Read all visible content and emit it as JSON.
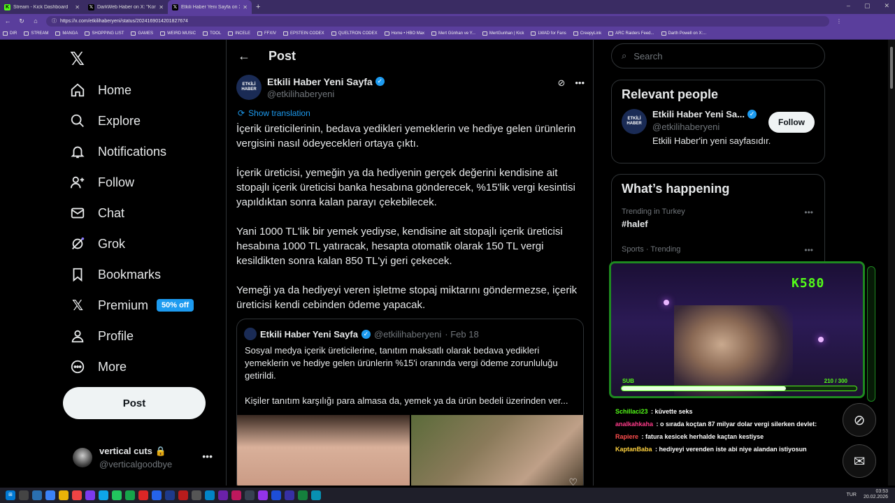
{
  "browser": {
    "tabs": [
      {
        "title": "Stream - Kick Dashboard",
        "icon": "kick"
      },
      {
        "title": "DarkWeb Haber on X: \"Konya Böy...",
        "icon": "x"
      },
      {
        "title": "Etkili Haber Yeni Sayfa on X: \"İçeri...",
        "icon": "x"
      }
    ],
    "url": "https://x.com/etkilihaberyeni/status/2024169014201827674",
    "bookmarks": [
      "DIR",
      "STREAM",
      "MANGA",
      "SHOPPING LIST",
      "GAMES",
      "WEIRD MUSIC",
      "TOOL",
      "INCELE",
      "FFXIV",
      "EPSTEIN CODEX",
      "QUELTRON CODEX",
      "Home • HBO Max",
      "Mert Günhan ve Y...",
      "MertGunhan | Kick",
      "LWAD for Fans",
      "CreepyLink",
      "ARC Raiders Feed...",
      "Darth Powell on X:..."
    ]
  },
  "nav": {
    "items": [
      {
        "label": "Home",
        "icon": "home-icon"
      },
      {
        "label": "Explore",
        "icon": "search-icon"
      },
      {
        "label": "Notifications",
        "icon": "bell-icon"
      },
      {
        "label": "Follow",
        "icon": "person-add-icon"
      },
      {
        "label": "Chat",
        "icon": "mail-icon"
      },
      {
        "label": "Grok",
        "icon": "grok-icon"
      },
      {
        "label": "Bookmarks",
        "icon": "bookmark-icon"
      },
      {
        "label": "Premium",
        "icon": "x-logo-icon"
      },
      {
        "label": "Profile",
        "icon": "person-icon"
      },
      {
        "label": "More",
        "icon": "more-circle-icon"
      }
    ],
    "premium_badge": "50% off",
    "post_button": "Post",
    "account": {
      "name": "vertical cuts",
      "handle": "@verticalgoodbye"
    }
  },
  "post": {
    "header": "Post",
    "author_name": "Etkili Haber Yeni Sayfa",
    "author_handle": "@etkilihaberyeni",
    "avatar_text": "ETKİLİ HABER",
    "show_translation": "Show translation",
    "paragraphs": [
      "İçerik üreticilerinin, bedava yedikleri yemeklerin ve hediye gelen ürünlerin vergisini nasıl ödeyecekleri ortaya çıktı.",
      "İçerik üreticisi, yemeğin ya da hediyenin gerçek değerini kendisine ait stopajlı içerik üreticisi banka hesabına gönderecek, %15'lik vergi kesintisi yapıldıktan sonra kalan parayı çekebilecek.",
      "Yani 1000 TL'lik bir yemek yediyse, kendisine ait stopajlı içerik üreticisi hesabına 1000 TL yatıracak, hesapta otomatik olarak 150 TL vergi kesildikten sonra kalan 850 TL'yi geri çekecek.",
      "Yemeği ya da hediyeyi veren işletme stopaj miktarını göndermezse, içerik üreticisi kendi cebinden ödeme yapacak."
    ],
    "quote": {
      "name": "Etkili Haber Yeni Sayfa",
      "handle": "@etkilihaberyeni",
      "date": "· Feb 18",
      "paragraphs": [
        "Sosyal medya içerik üreticilerine, tanıtım maksatlı olarak bedava yedikleri yemeklerin ve hediye gelen ürünlerin %15'i oranında vergi ödeme zorunluluğu getirildi.",
        "Kişiler tanıtım karşılığı para almasa da, yemek ya da ürün bedeli üzerinden ver..."
      ]
    }
  },
  "right": {
    "search_placeholder": "Search",
    "relevant_title": "Relevant people",
    "person": {
      "name": "Etkili Haber Yeni Sa...",
      "handle": "@etkilihaberyeni",
      "bio": "Etkili Haber'in yeni sayfasıdır.",
      "follow": "Follow",
      "avatar_text": "ETKİLİ HABER"
    },
    "happening_title": "What’s happening",
    "trends": [
      {
        "meta": "Trending in Turkey",
        "name": "#halef"
      },
      {
        "meta": "Sports · Trending",
        "name": ""
      }
    ]
  },
  "stream": {
    "count": "K580",
    "sub_label": "SUB",
    "sub_count": "210 / 300",
    "sub_progress": 0.7,
    "chat": [
      {
        "user": "Schillaci23",
        "msg": "kūvette seks",
        "color": "#53fc18"
      },
      {
        "user": "analkahkaha",
        "msg": "o sırada koçtan 87 milyar dolar vergi silerken devlet:",
        "color": "#ff3b8a"
      },
      {
        "user": "Rapiere",
        "msg": "fatura kesicek herhalde kaçtan kestiyse",
        "color": "#ff4d4d"
      },
      {
        "user": "KaptanBaba",
        "msg": "hediyeyi verenden iste abi niye alandan istiyosun",
        "color": "#ffd23f"
      }
    ]
  },
  "taskbar": {
    "lang": "TUR",
    "time": "03:53",
    "date": "20.02.2026"
  },
  "colors": {
    "accent": "#1d9bf0",
    "kick_green": "#53fc18",
    "browser": "#5a3e9c"
  }
}
